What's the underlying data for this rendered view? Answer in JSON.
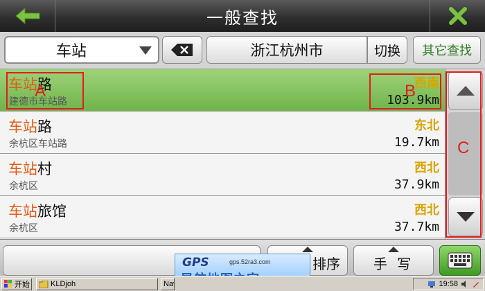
{
  "header": {
    "title": "一般查找",
    "back_icon": "back-arrow-icon",
    "close_icon": "close-x-icon"
  },
  "search": {
    "keyword": "车站",
    "city": "浙江杭州市",
    "switch_label": "切换",
    "other_label": "其它查找"
  },
  "results": [
    {
      "name_hl": "车站",
      "name_rest": "路",
      "sub": "建德市车站路",
      "dir": "西南",
      "dist": "103.9km",
      "selected": true
    },
    {
      "name_hl": "车站",
      "name_rest": "路",
      "sub": "余杭区车站路",
      "dir": "东北",
      "dist": "19.7km",
      "selected": false
    },
    {
      "name_hl": "车站",
      "name_rest": "村",
      "sub": "余杭区",
      "dir": "西北",
      "dist": "37.9km",
      "selected": false
    },
    {
      "name_hl": "车站",
      "name_rest": "旅馆",
      "sub": "余杭区",
      "dir": "西北",
      "dist": "37.7km",
      "selected": false
    }
  ],
  "annotations": {
    "a": "A",
    "b": "B",
    "c": "C"
  },
  "toolbar": {
    "sort_label": "排序",
    "handwrite_label": "手 写"
  },
  "logo": {
    "gps": "GPS",
    "url": "gps.52ra3.com",
    "cn": "导航地图之家"
  },
  "taskbar": {
    "start": "开始",
    "task1": "KLDjoh",
    "task2": "Nav",
    "clock": "19:58"
  },
  "colors": {
    "highlight": "#e25a13",
    "direction": "#d7a400",
    "selected_row": "#7fbd57",
    "annotation": "#e11d1d"
  }
}
